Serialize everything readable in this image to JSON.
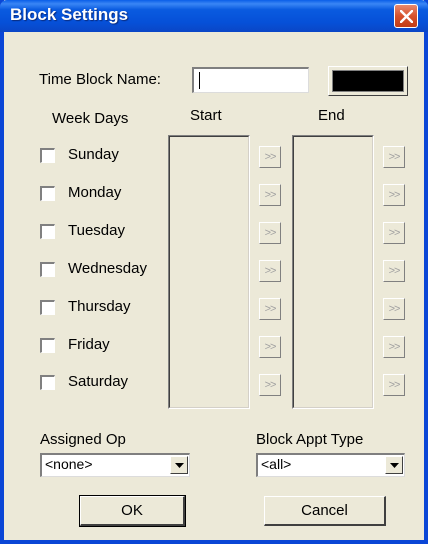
{
  "window": {
    "title": "Block Settings"
  },
  "form": {
    "time_block_name_label": "Time Block Name:",
    "time_block_name_value": "",
    "color_value": "#000000",
    "week_days_label": "Week Days",
    "start_label": "Start",
    "end_label": "End",
    "days": [
      {
        "label": "Sunday",
        "checked": false
      },
      {
        "label": "Monday",
        "checked": false
      },
      {
        "label": "Tuesday",
        "checked": false
      },
      {
        "label": "Wednesday",
        "checked": false
      },
      {
        "label": "Thursday",
        "checked": false
      },
      {
        "label": "Friday",
        "checked": false
      },
      {
        "label": "Saturday",
        "checked": false
      }
    ],
    "arrow_label": ">>",
    "assigned_op_label": "Assigned Op",
    "assigned_op_value": "<none>",
    "block_appt_type_label": "Block Appt Type",
    "block_appt_type_value": "<all>"
  },
  "buttons": {
    "ok": "OK",
    "cancel": "Cancel"
  },
  "icons": {
    "close": "close-icon",
    "dropdown": "chevron-down-icon"
  }
}
